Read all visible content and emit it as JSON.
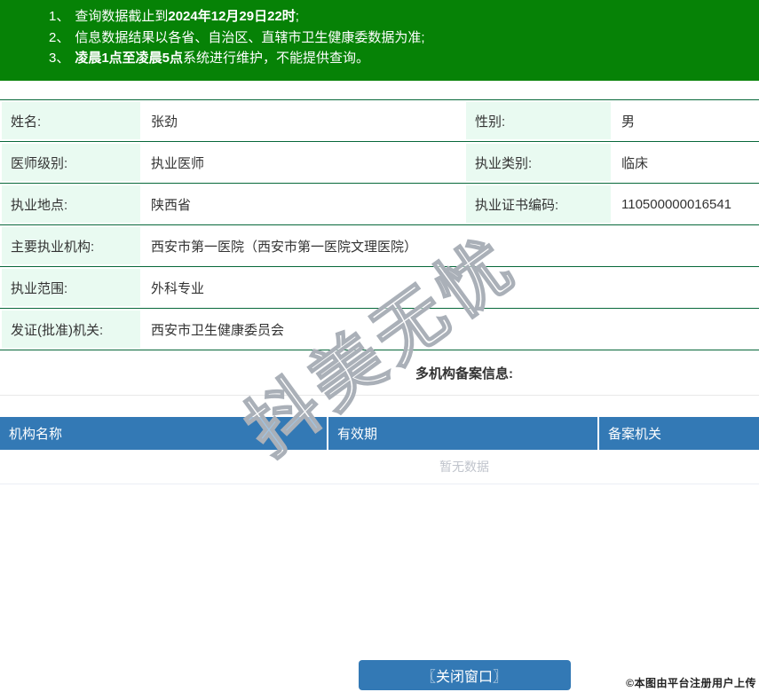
{
  "colors": {
    "banner_green": "#068206",
    "row_border_green": "#07683a",
    "label_bg_mint": "#e9faf1",
    "header_blue": "#3379b5",
    "empty_text_gray": "#c0c4cc"
  },
  "notice": {
    "lines": [
      {
        "num": "1、",
        "pre": "查询数据截止到",
        "bold": "2024年12月29日22时",
        "post": ";"
      },
      {
        "num": "2、",
        "pre": "信息数据结果以各省、自治区、直辖市卫生健康委数据为准;",
        "bold": "",
        "post": ""
      },
      {
        "num": "3、",
        "pre": "",
        "bold": "凌晨1点至凌晨5点",
        "post": "系统进行维护，不能提供查询。"
      }
    ]
  },
  "doctor": {
    "rows_half": [
      {
        "l1": "姓名:",
        "v1": "张劲",
        "l2": "性别:",
        "v2": "男"
      },
      {
        "l1": "医师级别:",
        "v1": "执业医师",
        "l2": "执业类别:",
        "v2": "临床"
      },
      {
        "l1": "执业地点:",
        "v1": "陕西省",
        "l2": "执业证书编码:",
        "v2": "110500000016541"
      }
    ],
    "rows_full": [
      {
        "label": "主要执业机构:",
        "value": "西安市第一医院（西安市第一医院文理医院）"
      },
      {
        "label": "执业范围:",
        "value": "外科专业"
      },
      {
        "label": "发证(批准)机关:",
        "value": "西安市卫生健康委员会"
      }
    ]
  },
  "multi_org": {
    "title": "多机构备案信息:",
    "columns": [
      "机构名称",
      "有效期",
      "备案机关"
    ],
    "empty_text": "暂无数据"
  },
  "footer": {
    "close_button": "〖关闭窗口〗",
    "credit": "©本图由平台注册用户上传"
  },
  "watermark": "抖美无忧"
}
